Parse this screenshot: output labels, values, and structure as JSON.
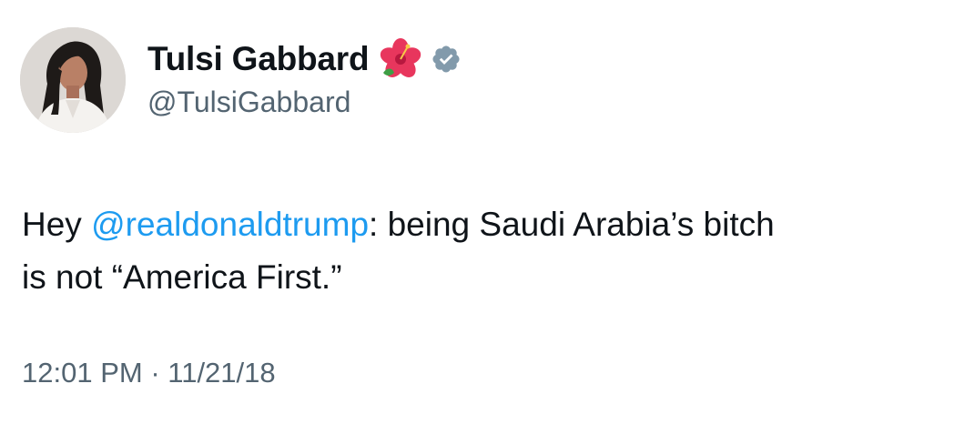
{
  "author": {
    "display_name": "Tulsi Gabbard",
    "handle": "@TulsiGabbard",
    "emoji_icon": "hibiscus-icon",
    "verified_icon": "verified-badge-icon"
  },
  "tweet": {
    "text_before": "Hey ",
    "mention": "@realdonaldtrump",
    "text_after_line1": ": being Saudi Arabia’s bitch",
    "text_line2": "is not “America First.”"
  },
  "meta": {
    "time": "12:01 PM",
    "separator": " · ",
    "date": "11/21/18"
  },
  "colors": {
    "text": "#0f1419",
    "secondary": "#536471",
    "link": "#1d9bf0",
    "verified": "#829aab"
  }
}
